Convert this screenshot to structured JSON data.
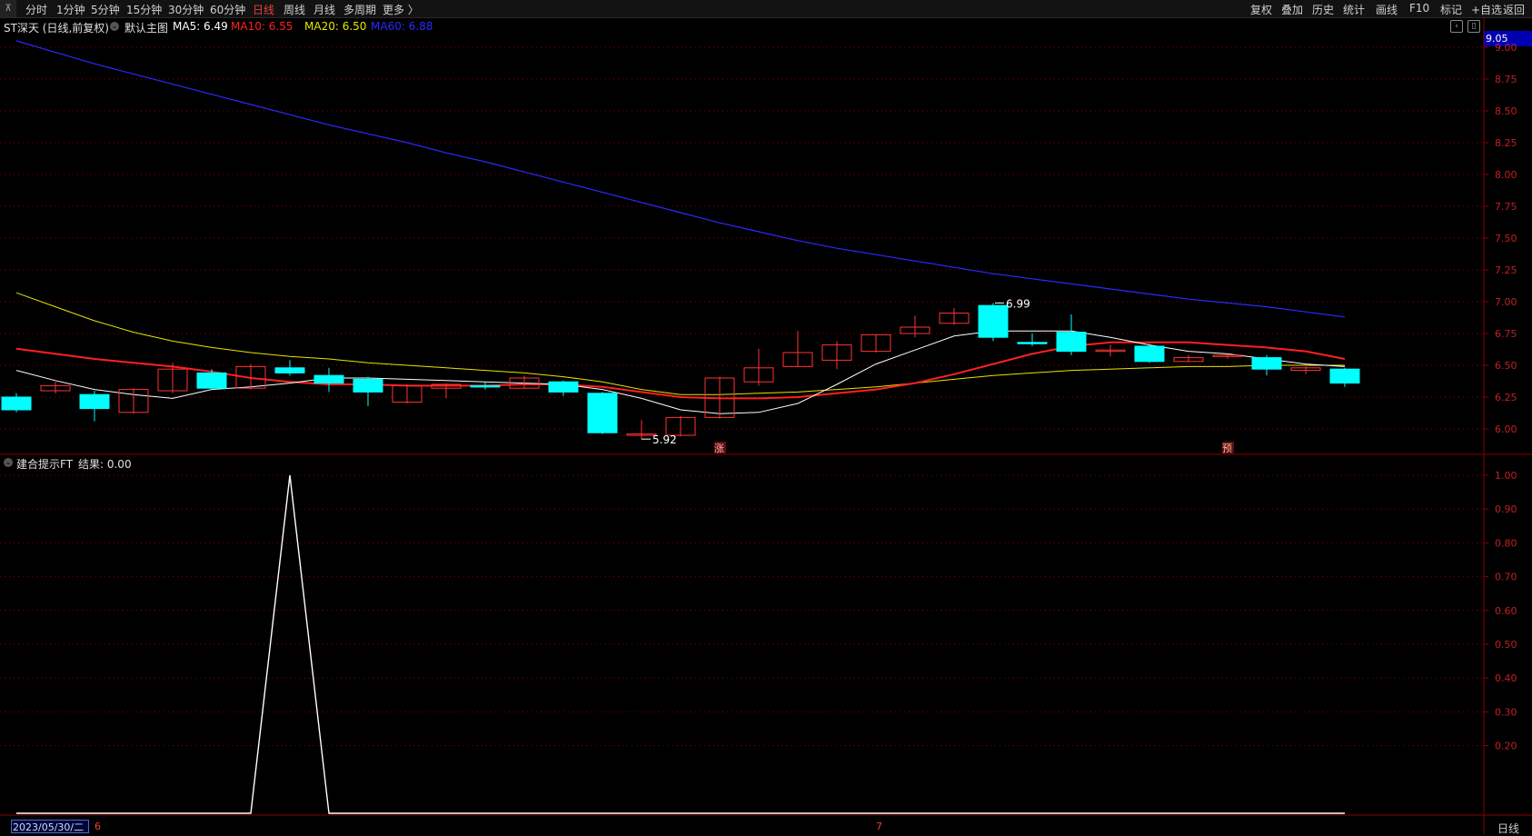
{
  "toolbar": {
    "left_items": [
      {
        "label": "分时"
      },
      {
        "label": "1分钟"
      },
      {
        "label": "5分钟"
      },
      {
        "label": "15分钟"
      },
      {
        "label": "30分钟"
      },
      {
        "label": "60分钟"
      },
      {
        "label": "日线",
        "active": true
      },
      {
        "label": "周线"
      },
      {
        "label": "月线"
      },
      {
        "label": "多周期"
      },
      {
        "label": "更多 〉"
      }
    ],
    "right_items": [
      {
        "label": "复权"
      },
      {
        "label": "叠加"
      },
      {
        "label": "历史"
      },
      {
        "label": "统计"
      },
      {
        "label": "画线"
      },
      {
        "label": "F10"
      },
      {
        "label": "标记"
      },
      {
        "label": "+自选"
      },
      {
        "label": "返回"
      }
    ]
  },
  "main_chart": {
    "title": "ST深天 (日线,前复权)",
    "template": "默认主图",
    "ma_labels": [
      {
        "text": "MA5: 6.49",
        "color": "#ffffff"
      },
      {
        "text": "MA10: 6.55",
        "color": "#ff2020"
      },
      {
        "text": "MA20: 6.50",
        "color": "#e6e600"
      },
      {
        "text": "MA60: 6.88",
        "color": "#2a2aff"
      }
    ],
    "current_price_label": "9.05",
    "high_label": "6.99",
    "low_label": "5.92",
    "markers": [
      {
        "text": "涨"
      },
      {
        "text": "预"
      }
    ],
    "y_ticks": [
      "9.00",
      "8.75",
      "8.50",
      "8.25",
      "8.00",
      "7.75",
      "7.50",
      "7.25",
      "7.00",
      "6.75",
      "6.50",
      "6.25",
      "6.00"
    ]
  },
  "indicator_chart": {
    "title": "建合提示FT",
    "result": "结果: 0.00",
    "y_ticks": [
      "1.00",
      "0.90",
      "0.80",
      "0.70",
      "0.60",
      "0.50",
      "0.40",
      "0.30",
      "0.20"
    ]
  },
  "bottom_axis": {
    "date": "2023/05/30/二",
    "month_6": "6",
    "month_7": "7",
    "period": "日线"
  },
  "colors": {
    "up": "#ff3333",
    "down": "#00ffff",
    "ma5": "#ffffff",
    "ma10": "#ff2020",
    "ma20": "#e6e600",
    "ma60": "#2a2aff",
    "grid": "#8b0000",
    "axis_text": "#c02020"
  },
  "chart_data": {
    "type": "candlestick",
    "ylim": [
      5.8,
      9.1
    ],
    "candles": [
      {
        "o": 6.25,
        "h": 6.28,
        "l": 6.13,
        "c": 6.15
      },
      {
        "o": 6.3,
        "h": 6.37,
        "l": 6.28,
        "c": 6.34
      },
      {
        "o": 6.27,
        "h": 6.3,
        "l": 6.06,
        "c": 6.16
      },
      {
        "o": 6.13,
        "h": 6.32,
        "l": 6.12,
        "c": 6.31
      },
      {
        "o": 6.3,
        "h": 6.52,
        "l": 6.28,
        "c": 6.47
      },
      {
        "o": 6.44,
        "h": 6.47,
        "l": 6.31,
        "c": 6.32
      },
      {
        "o": 6.32,
        "h": 6.51,
        "l": 6.31,
        "c": 6.49
      },
      {
        "o": 6.48,
        "h": 6.54,
        "l": 6.42,
        "c": 6.44
      },
      {
        "o": 6.42,
        "h": 6.48,
        "l": 6.29,
        "c": 6.36
      },
      {
        "o": 6.39,
        "h": 6.41,
        "l": 6.18,
        "c": 6.29
      },
      {
        "o": 6.21,
        "h": 6.35,
        "l": 6.2,
        "c": 6.34
      },
      {
        "o": 6.32,
        "h": 6.36,
        "l": 6.24,
        "c": 6.35
      },
      {
        "o": 6.34,
        "h": 6.37,
        "l": 6.31,
        "c": 6.33
      },
      {
        "o": 6.32,
        "h": 6.42,
        "l": 6.32,
        "c": 6.4
      },
      {
        "o": 6.37,
        "h": 6.38,
        "l": 6.26,
        "c": 6.29
      },
      {
        "o": 6.28,
        "h": 6.29,
        "l": 5.96,
        "c": 5.97
      },
      {
        "o": 5.96,
        "h": 6.07,
        "l": 5.92,
        "c": 5.96
      },
      {
        "o": 5.95,
        "h": 6.1,
        "l": 5.94,
        "c": 6.09
      },
      {
        "o": 6.09,
        "h": 6.41,
        "l": 6.08,
        "c": 6.4
      },
      {
        "o": 6.37,
        "h": 6.63,
        "l": 6.34,
        "c": 6.48
      },
      {
        "o": 6.49,
        "h": 6.77,
        "l": 6.49,
        "c": 6.6
      },
      {
        "o": 6.54,
        "h": 6.69,
        "l": 6.47,
        "c": 6.66
      },
      {
        "o": 6.61,
        "h": 6.74,
        "l": 6.6,
        "c": 6.74
      },
      {
        "o": 6.75,
        "h": 6.89,
        "l": 6.72,
        "c": 6.8
      },
      {
        "o": 6.83,
        "h": 6.95,
        "l": 6.82,
        "c": 6.91
      },
      {
        "o": 6.97,
        "h": 6.99,
        "l": 6.69,
        "c": 6.72
      },
      {
        "o": 6.68,
        "h": 6.75,
        "l": 6.65,
        "c": 6.67
      },
      {
        "o": 6.76,
        "h": 6.9,
        "l": 6.58,
        "c": 6.61
      },
      {
        "o": 6.62,
        "h": 6.66,
        "l": 6.57,
        "c": 6.62
      },
      {
        "o": 6.65,
        "h": 6.67,
        "l": 6.52,
        "c": 6.53
      },
      {
        "o": 6.53,
        "h": 6.58,
        "l": 6.53,
        "c": 6.56
      },
      {
        "o": 6.57,
        "h": 6.59,
        "l": 6.55,
        "c": 6.58
      },
      {
        "o": 6.56,
        "h": 6.58,
        "l": 6.42,
        "c": 6.47
      },
      {
        "o": 6.46,
        "h": 6.49,
        "l": 6.43,
        "c": 6.48
      },
      {
        "o": 6.47,
        "h": 6.48,
        "l": 6.33,
        "c": 6.36
      }
    ],
    "ma5": [
      6.46,
      6.38,
      6.31,
      6.27,
      6.24,
      6.31,
      6.33,
      6.36,
      6.4,
      6.4,
      6.39,
      6.38,
      6.37,
      6.36,
      6.35,
      6.31,
      6.24,
      6.15,
      6.12,
      6.13,
      6.2,
      6.35,
      6.51,
      6.62,
      6.73,
      6.77,
      6.77,
      6.77,
      6.72,
      6.66,
      6.61,
      6.59,
      6.55,
      6.51,
      6.49
    ],
    "ma10": [
      6.63,
      6.59,
      6.55,
      6.52,
      6.49,
      6.45,
      6.4,
      6.37,
      6.35,
      6.35,
      6.34,
      6.34,
      6.34,
      6.35,
      6.35,
      6.33,
      6.29,
      6.25,
      6.24,
      6.24,
      6.25,
      6.28,
      6.31,
      6.36,
      6.43,
      6.51,
      6.59,
      6.65,
      6.68,
      6.68,
      6.68,
      6.66,
      6.64,
      6.61,
      6.55
    ],
    "ma20": [
      7.07,
      6.96,
      6.85,
      6.76,
      6.69,
      6.64,
      6.6,
      6.57,
      6.55,
      6.52,
      6.5,
      6.48,
      6.46,
      6.44,
      6.41,
      6.37,
      6.31,
      6.27,
      6.27,
      6.28,
      6.29,
      6.31,
      6.33,
      6.36,
      6.39,
      6.42,
      6.44,
      6.46,
      6.47,
      6.48,
      6.49,
      6.49,
      6.5,
      6.5,
      6.5
    ],
    "ma60": [
      9.05,
      8.96,
      8.87,
      8.79,
      8.71,
      8.63,
      8.55,
      8.47,
      8.39,
      8.32,
      8.25,
      8.17,
      8.1,
      8.02,
      7.94,
      7.86,
      7.78,
      7.7,
      7.62,
      7.55,
      7.48,
      7.42,
      7.37,
      7.32,
      7.27,
      7.22,
      7.18,
      7.14,
      7.1,
      7.06,
      7.02,
      6.99,
      6.96,
      6.92,
      6.88
    ],
    "indicator": [
      0,
      0,
      0,
      0,
      0,
      0,
      0,
      1,
      0,
      0,
      0,
      0,
      0,
      0,
      0,
      0,
      0,
      0,
      0,
      0,
      0,
      0,
      0,
      0,
      0,
      0,
      0,
      0,
      0,
      0,
      0,
      0,
      0,
      0,
      0
    ]
  }
}
